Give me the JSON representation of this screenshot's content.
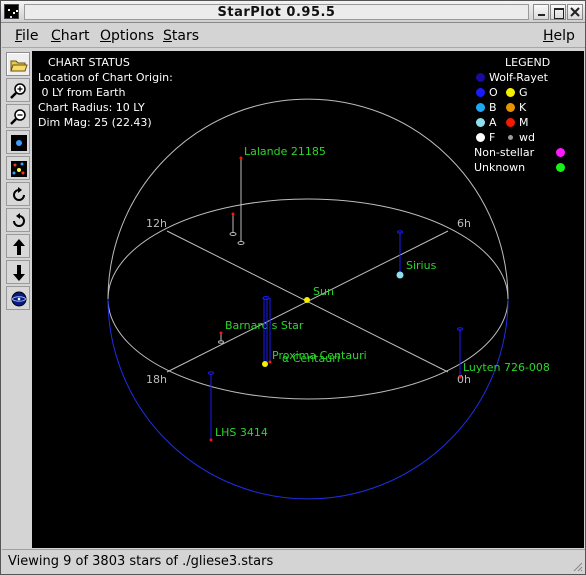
{
  "window": {
    "title": "StarPlot 0.95.5"
  },
  "menubar": {
    "file": {
      "mnemonic": "F",
      "rest": "ile"
    },
    "chart": {
      "mnemonic": "C",
      "rest": "hart"
    },
    "options": {
      "mnemonic": "O",
      "rest": "ptions"
    },
    "stars": {
      "mnemonic": "S",
      "rest": "tars"
    },
    "help": {
      "mnemonic": "H",
      "rest": "elp"
    }
  },
  "toolbar": {
    "tools": [
      "open-folder-icon",
      "zoom-in-icon",
      "zoom-out-icon",
      "magnitude-decrease-icon",
      "magnitude-increase-icon",
      "rotate-clockwise-icon",
      "rotate-counterclockwise-icon",
      "tilt-up-icon",
      "tilt-down-icon",
      "reset-view-icon"
    ]
  },
  "chart_status": {
    "heading": "CHART STATUS",
    "origin_label": "Location of Chart Origin:",
    "origin_value": " 0 LY from Earth",
    "radius": "Chart Radius: 10 LY",
    "dim_mag": "Dim Mag: 25 (22.43)"
  },
  "legend": {
    "title": "LEGEND",
    "wolf_rayet": {
      "label": "Wolf-Rayet",
      "color": "#1a0aa0"
    },
    "o": {
      "label": "O",
      "color": "#1a1aff"
    },
    "g": {
      "label": "G",
      "color": "#f2f200"
    },
    "b": {
      "label": "B",
      "color": "#1ea8f0"
    },
    "k": {
      "label": "K",
      "color": "#e89400"
    },
    "a": {
      "label": "A",
      "color": "#8fe0ef"
    },
    "m": {
      "label": "M",
      "color": "#f21a00"
    },
    "f": {
      "label": "F",
      "color": "#ffffff"
    },
    "wd": {
      "label": "wd",
      "color": "#9a9a9a"
    },
    "non_stellar": {
      "label": "Non-stellar",
      "color": "#ff19ff"
    },
    "unknown": {
      "label": "Unknown",
      "color": "#19ef19"
    }
  },
  "chart": {
    "hour_labels": {
      "h12": "12h",
      "h6": "6h",
      "h18": "18h",
      "h0": "0h"
    },
    "star_label_color": "#2ad62a",
    "stars": {
      "lalande": "Lalande 21185",
      "sirius": "Sirius",
      "sun": "Sun",
      "barnard": "Barnard's Star",
      "proxima": "Proxima Centauri",
      "alpha_cen": "α Centauri",
      "luyten": "Luyten 726-008",
      "lhs": "LHS 3414"
    }
  },
  "statusbar": {
    "text": "Viewing 9 of 3803 stars of ./gliese3.stars"
  }
}
